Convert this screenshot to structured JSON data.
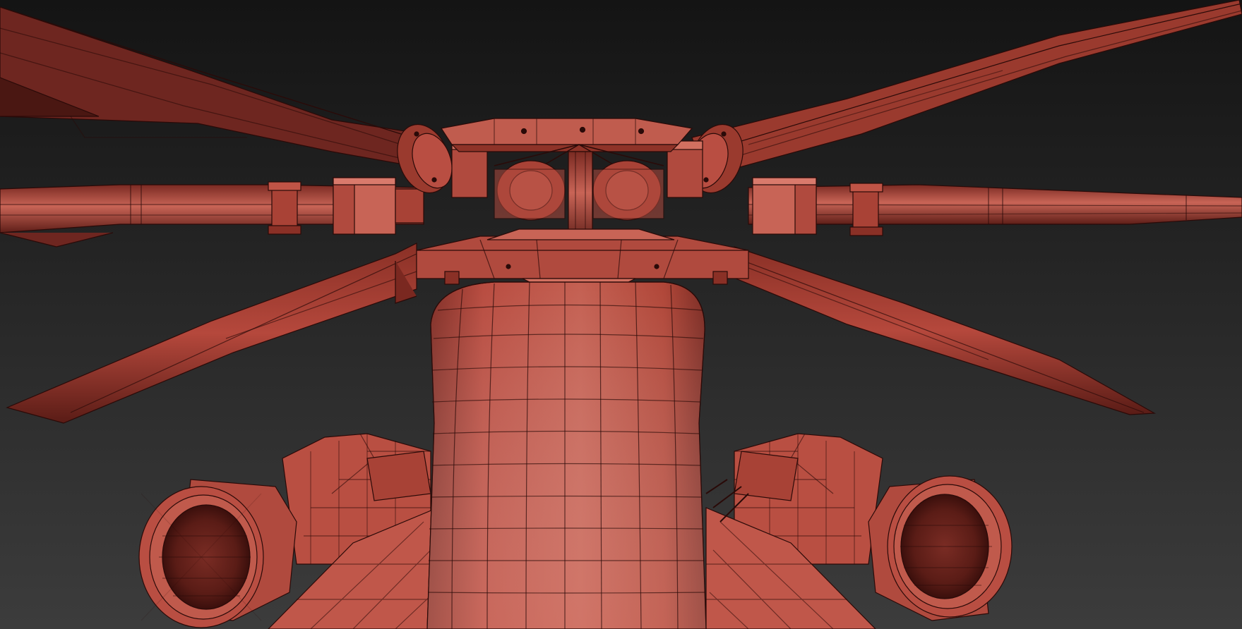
{
  "viewport": {
    "background_top": "#141414",
    "background_bottom": "#3c3c3c"
  },
  "model": {
    "subject": "helicopter-main-rotor-hub-wireframe",
    "shading": "solid-with-wireframe-edges",
    "colors": {
      "base": "#b5483c",
      "light": "#d0685a",
      "highlight": "#e08a7c",
      "dark": "#6e2620",
      "deep": "#3e120e",
      "edge": "#2a0a08"
    }
  }
}
